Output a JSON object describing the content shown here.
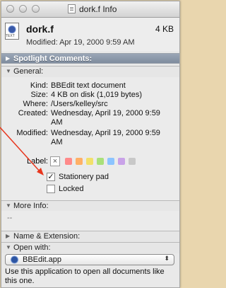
{
  "window": {
    "title": "dork.f Info"
  },
  "file": {
    "name": "dork.f",
    "size": "4 KB",
    "modified": "Modified: Apr 19, 2000 9:59 AM",
    "icon_tag": "TEXT"
  },
  "sections": {
    "spotlight": "Spotlight Comments:",
    "general": "General:",
    "more_info": "More Info:",
    "more_info_value": "--",
    "name_ext": "Name & Extension:",
    "open_with": "Open with:"
  },
  "general": {
    "kind_label": "Kind:",
    "kind_value": "BBEdit text document",
    "size_label": "Size:",
    "size_value": "4 KB on disk (1,019 bytes)",
    "where_label": "Where:",
    "where_value": "/Users/kelley/src",
    "created_label": "Created:",
    "created_value_line1": "Wednesday, April 19, 2000 9:59",
    "created_value_line2": "AM",
    "modified_label": "Modified:",
    "modified_value_line1": "Wednesday, April 19, 2000 9:59",
    "modified_value_line2": "AM",
    "label_label": "Label:",
    "label_x": "×",
    "label_colors": [
      "#ff8a8a",
      "#ffb066",
      "#f2e06a",
      "#a9e07a",
      "#8cc4ff",
      "#c9a2e8",
      "#c8c8c8"
    ]
  },
  "checkboxes": {
    "stationery_label": "Stationery pad",
    "stationery_checked": true,
    "stationery_mark": "✓",
    "locked_label": "Locked",
    "locked_checked": false
  },
  "open_with": {
    "app": "BBEdit.app",
    "arrows": "⬍",
    "description": "Use this application to open all documents like this one."
  },
  "colors": {
    "arrow": "#e8361e",
    "spotlight_bar": "#8b97a8",
    "desktop": "#e9d6ae"
  }
}
